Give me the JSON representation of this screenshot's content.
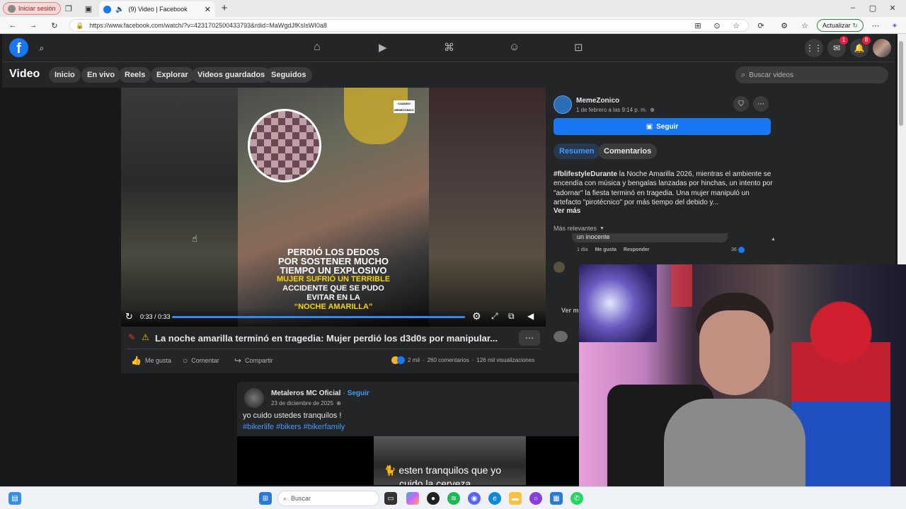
{
  "browser": {
    "profile_label": "Iniciar sesión",
    "tab_title": "(9) Video | Facebook",
    "url": "https://www.facebook.com/watch/?v=4231702500433793&rdid=MaWgdJfKsIsWI0a8",
    "update_label": "Actualizar"
  },
  "header": {
    "messenger_badge": "1",
    "notifications_badge": "8"
  },
  "subnav": {
    "title": "Video",
    "tabs": [
      "Inicio",
      "En vivo",
      "Reels",
      "Explorar",
      "Videos guardados",
      "Seguidos"
    ],
    "search_placeholder": "Buscar videos"
  },
  "player": {
    "watermark": "CUANDO MEMEZONICO",
    "caption_white_1": "PERDIÓ LOS DEDOS",
    "caption_white_2": "POR SOSTENER MUCHO",
    "caption_white_3": "TIEMPO UN EXPLOSIVO",
    "caption_yellow_1": "MUJER SUFRIÓ UN TERRIBLE",
    "caption_white_4": "ACCIDENTE QUE SE PUDO",
    "caption_white_5": "EVITAR EN LA",
    "caption_yellow_2": "“NOCHE AMARILLA”",
    "time": "0:33 / 0:33",
    "progress_fraction": 1.0
  },
  "video_info": {
    "title": "La noche amarilla terminó en tragedia: Mujer perdió los d3d0s por manipular...",
    "like_label": "Me gusta",
    "comment_label": "Comentar",
    "share_label": "Compartir",
    "reactions_count": "2 mil",
    "comments_count": "260 comentarios",
    "views_count": "126 mil visualizaciones"
  },
  "right_panel": {
    "page_name": "MemeZonico",
    "post_date": "1 de febrero a las 9:14 p. m.",
    "follow_label": "Seguir",
    "tab_summary": "Resumen",
    "tab_comments": "Comentarios",
    "hashtag": "#fblifestyleDurante",
    "description": " la Noche Amarilla 2026, mientras el ambiente se encendía con música y bengalas lanzadas por hinchas, un intento por \"adornar\" la fiesta terminó en tragedia. Una mujer manipuló un artefacto \"pirotécnico\" por más tiempo del debido y...",
    "see_more": "Ver más",
    "sort_label": "Más relevantes",
    "comment_text": "un inocente",
    "comment_time": "1 día",
    "comment_like": "Me gusta",
    "comment_reply": "Responder",
    "comment_reactions": "36",
    "view_more_partial": "Ver m"
  },
  "post2": {
    "author": "Metaleros MC Oficial",
    "follow": "Seguir",
    "date": "23 de diciembre de 2025",
    "text": "yo cuido ustedes tranquilos !",
    "hashtags": "#bikerlife #bikers #bikerfamily",
    "video_caption": "esten tranquilos que yo",
    "video_caption_2": "cuido la cerveza"
  },
  "taskbar": {
    "search_placeholder": "Buscar"
  }
}
